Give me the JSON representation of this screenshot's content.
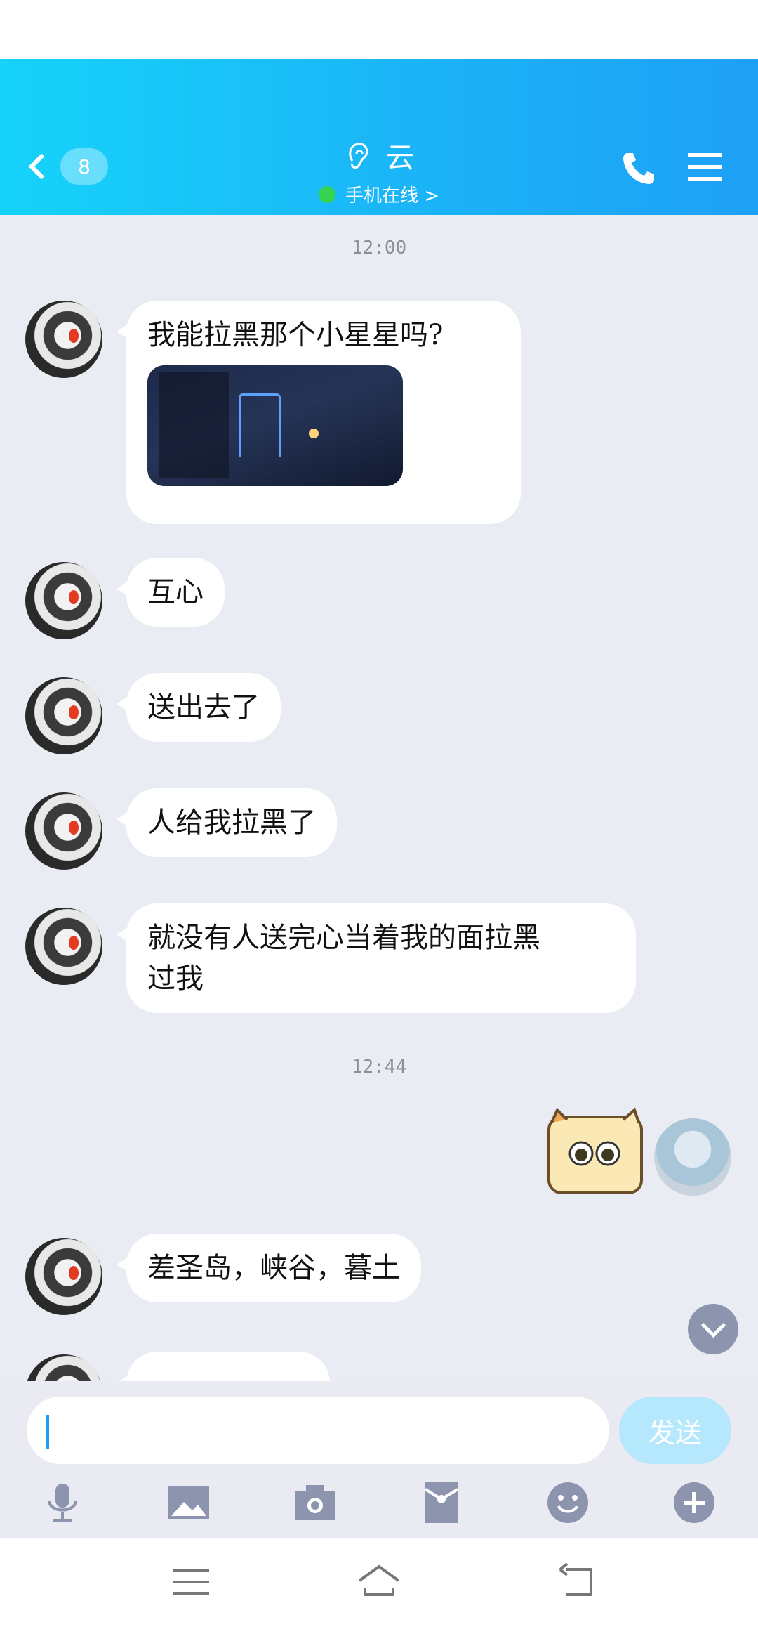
{
  "header": {
    "unread_count": "8",
    "contact_name": "云",
    "presence_text": "手机在线 >"
  },
  "messages": [
    {
      "time": "12:00"
    },
    {
      "text": "我能拉黑那个小星星吗?"
    },
    {
      "text": "互心"
    },
    {
      "text": "送出去了"
    },
    {
      "text": "人给我拉黑了"
    },
    {
      "text_line1": "就没有人送完心当着我的面拉黑",
      "text_line2": "过我"
    },
    {
      "time": "12:44"
    },
    {
      "text": "差圣岛，峡谷，暮土"
    }
  ],
  "composer": {
    "input_value": "",
    "send_label": "发送"
  },
  "colors": {
    "header_gradient_start": "#16d3fa",
    "header_gradient_end": "#1ea0f5",
    "chat_background": "#eaecf4",
    "bubble": "#ffffff",
    "online": "#35d34f",
    "icon_gray": "#8d94ad"
  },
  "icons": [
    "back-chevron-icon",
    "ear-icon",
    "phone-icon",
    "menu-icon",
    "chevron-down-icon",
    "microphone-icon",
    "image-icon",
    "camera-icon",
    "red-packet-icon",
    "emoji-icon",
    "plus-icon",
    "nav-menu-icon",
    "nav-home-icon",
    "nav-back-icon"
  ]
}
